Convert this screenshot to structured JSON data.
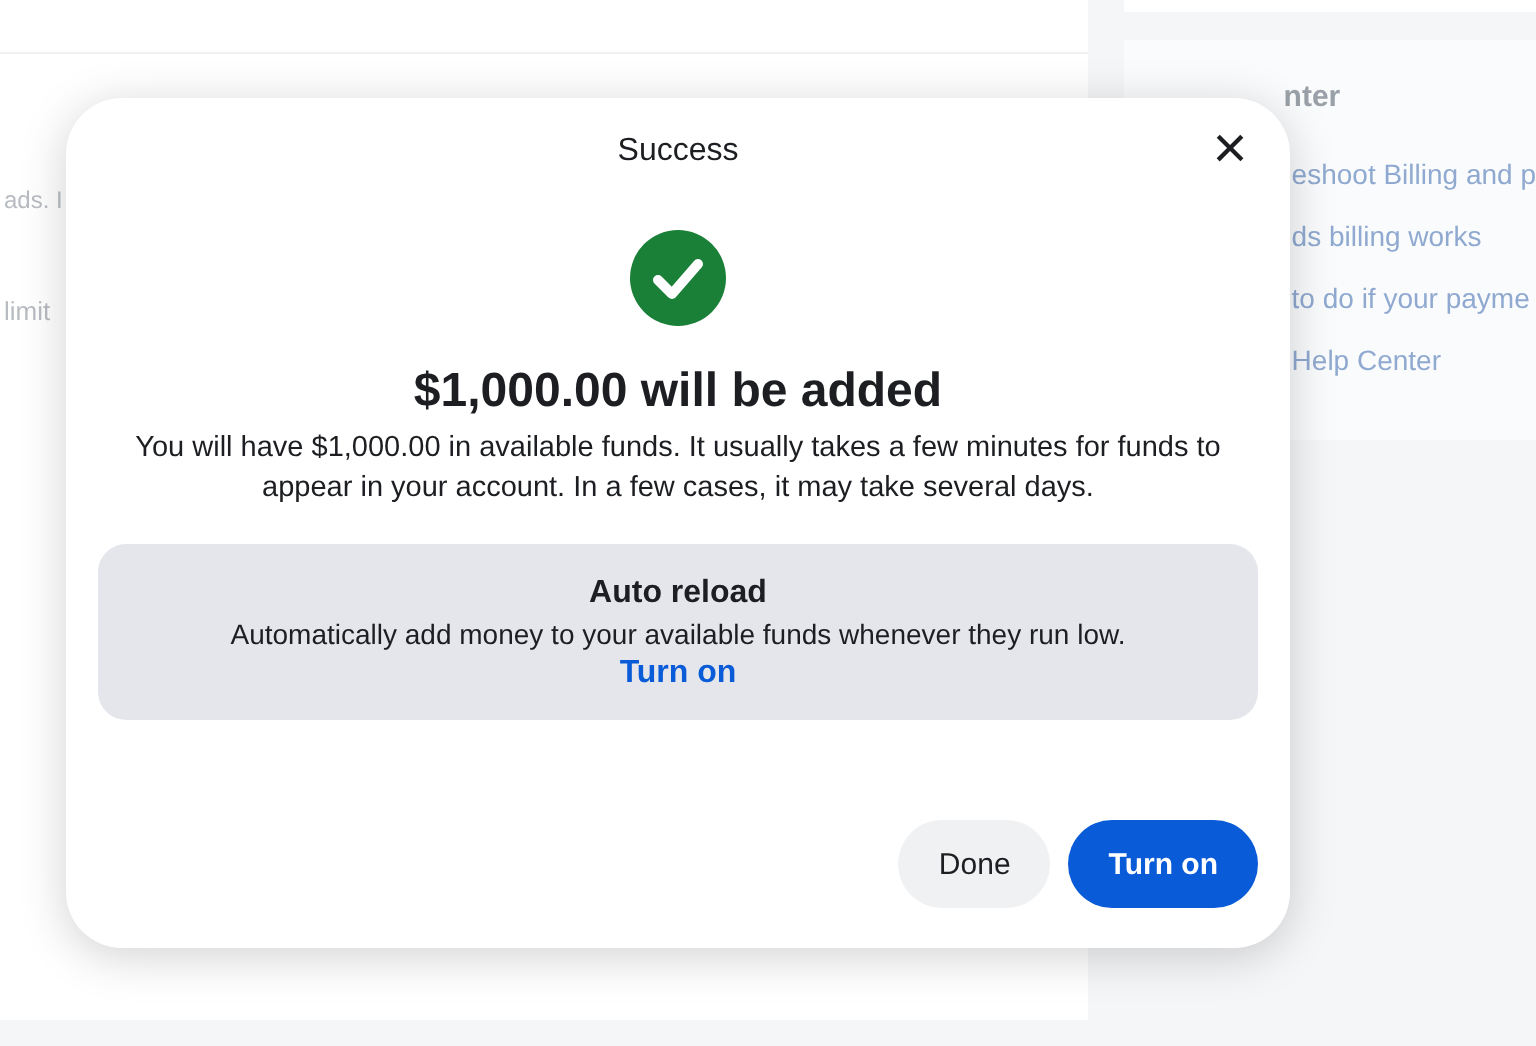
{
  "background": {
    "left_fragments": [
      "ads. I",
      "limit"
    ],
    "help_panel": {
      "title": "nter",
      "links": [
        "eshoot Billing and p",
        "ds billing works",
        "to do if your payme",
        "Help Center"
      ]
    }
  },
  "dialog": {
    "title": "Success",
    "close": "×",
    "heading": "$1,000.00 will be added",
    "message": "You will have $1,000.00 in available funds. It usually takes a few minutes for funds to appear in your account. In a few cases, it may take several days.",
    "auto_reload": {
      "title": "Auto reload",
      "description": "Automatically add money to your available funds whenever they run low.",
      "link": "Turn on"
    },
    "buttons": [
      {
        "label": "Done",
        "kind": "secondary"
      },
      {
        "label": "Turn on",
        "kind": "primary"
      }
    ]
  }
}
